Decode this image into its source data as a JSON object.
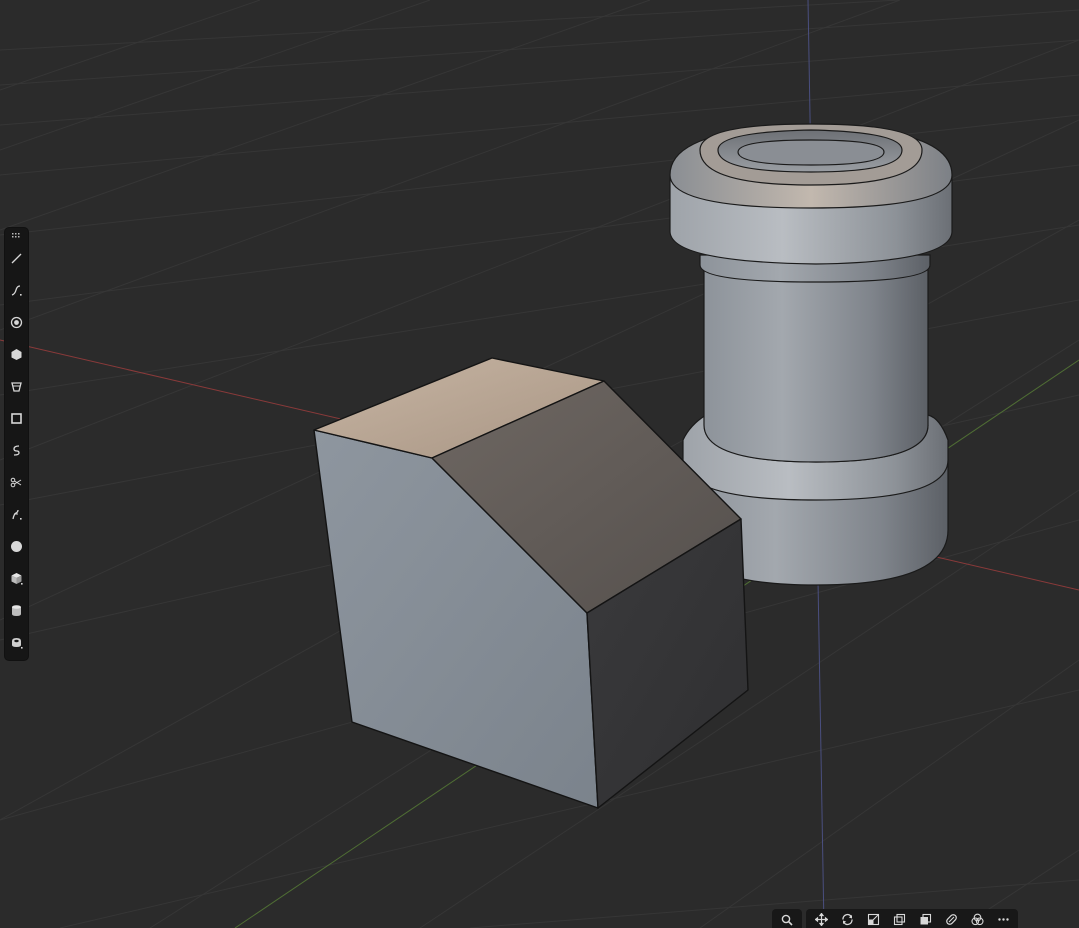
{
  "app": {
    "view": "3D Viewport"
  },
  "colors": {
    "background": "#2b2b2b",
    "grid_line": "#373737",
    "x_axis": "#8a3a3a",
    "y_axis": "#5c7a3a",
    "z_axis": "#4a4f80",
    "mesh_light": "#b8b8b8",
    "mesh_dark": "#3d3d3d",
    "mesh_top": "#b0a090",
    "toolbar_bg": "#161616",
    "icon": "#d8d8d8"
  },
  "scene": {
    "objects": [
      {
        "name": "stepped-block",
        "type": "mesh"
      },
      {
        "name": "pipe-fitting",
        "type": "mesh"
      }
    ]
  },
  "toolshelf": {
    "tools": [
      {
        "name": "draw-line-tool-icon"
      },
      {
        "name": "draw-curve-tool-icon"
      },
      {
        "name": "add-circle-tool-icon"
      },
      {
        "name": "add-polygon-tool-icon"
      },
      {
        "name": "add-cone-tool-icon"
      },
      {
        "name": "add-box-tool-icon"
      },
      {
        "name": "add-spiral-tool-icon"
      },
      {
        "name": "cut-tool-icon"
      },
      {
        "name": "freehand-curve-tool-icon"
      },
      {
        "name": "add-sphere-tool-icon"
      },
      {
        "name": "add-cube-tool-icon"
      },
      {
        "name": "add-cylinder-tool-icon"
      },
      {
        "name": "add-torus-tool-icon"
      }
    ]
  },
  "bottombar": {
    "buttons": [
      {
        "name": "search-icon"
      },
      {
        "name": "move-icon"
      },
      {
        "name": "rotate-icon"
      },
      {
        "name": "scale-icon"
      },
      {
        "name": "duplicate-icon"
      },
      {
        "name": "boolean-icon"
      },
      {
        "name": "modifier-icon"
      },
      {
        "name": "shading-icon"
      },
      {
        "name": "more-icon"
      }
    ]
  }
}
